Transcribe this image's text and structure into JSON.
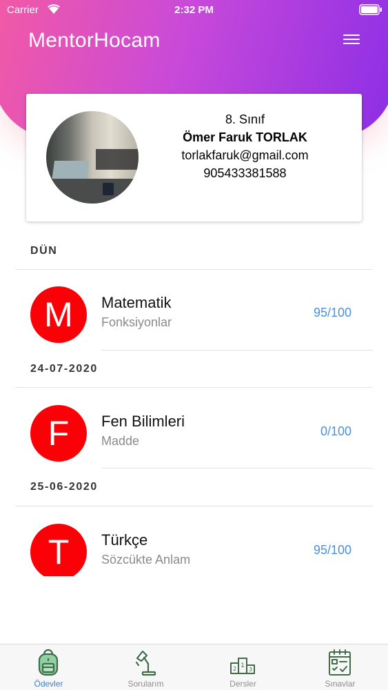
{
  "status_bar": {
    "carrier": "Carrier",
    "time": "2:32 PM"
  },
  "header": {
    "app_title": "MentorHocam"
  },
  "profile": {
    "grade": "8. Sınıf",
    "name": "Ömer Faruk TORLAK",
    "email": "torlakfaruk@gmail.com",
    "phone": "905433381588"
  },
  "sections": [
    {
      "date": "DÜN",
      "item": {
        "initial": "M",
        "subject": "Matematik",
        "topic": "Fonksiyonlar",
        "score": "95/100"
      }
    },
    {
      "date": "24-07-2020",
      "item": {
        "initial": "F",
        "subject": "Fen Bilimleri",
        "topic": "Madde",
        "score": "0/100"
      }
    },
    {
      "date": "25-06-2020",
      "item": {
        "initial": "T",
        "subject": "Türkçe",
        "topic": "Sözcükte Anlam",
        "score": "95/100"
      }
    }
  ],
  "tabs": [
    {
      "label": "Ödevler",
      "icon": "backpack-icon",
      "active": true
    },
    {
      "label": "Sorularım",
      "icon": "desk-lamp-icon",
      "active": false
    },
    {
      "label": "Dersler",
      "icon": "podium-icon",
      "active": false
    },
    {
      "label": "Sınavlar",
      "icon": "checklist-calendar-icon",
      "active": false
    }
  ],
  "colors": {
    "header_gradient_start": "#f35aa4",
    "header_gradient_end": "#8b2ee6",
    "avatar_red": "#fb0007",
    "score_blue": "#4a8fe0",
    "tab_active": "#3d7fd6",
    "tab_icon_green": "#3f6b47"
  }
}
